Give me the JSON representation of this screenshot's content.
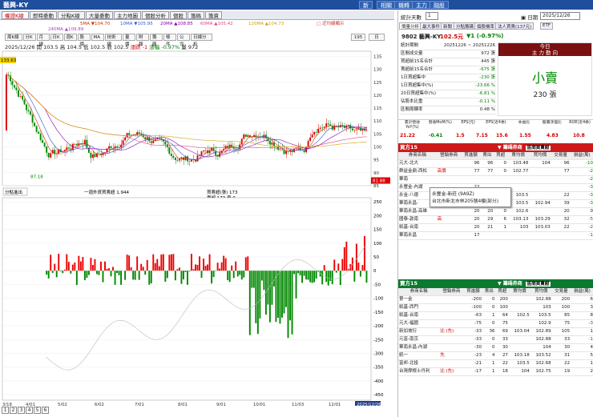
{
  "window": {
    "title": "藝興-KY",
    "tabs": [
      "新",
      "相關",
      "機轉",
      "主力",
      "融股"
    ]
  },
  "left_tabs": [
    "權證K線",
    "即時委動",
    "分點K線",
    "大量委動",
    "主力地圖",
    "個股分析",
    "個股",
    "籌碼",
    "籌資"
  ],
  "ma": [
    "5MA ▼104.70",
    "10MA ▼105.95",
    "20MA ▲108.85",
    "60MA ▲105.42",
    "120MA ▲104.73",
    "240MA ▲109.89"
  ],
  "ma_colors": [
    "#cc3300",
    "#3355cc",
    "#8800aa",
    "#e0457a",
    "#d4a000",
    "#aa44cc"
  ],
  "ma_note": "□ 近均線顯示",
  "toolbar": [
    "周K線",
    "分K",
    "月線",
    "日K",
    "週K",
    "股價",
    "MA",
    "技術線",
    "量價",
    "財報",
    "籌碼",
    "條件",
    "公司",
    "日線分析"
  ],
  "toolbar_select": "195",
  "price": {
    "date": "2025/12/26",
    "open": "開 103.5",
    "high": "高 104.5",
    "low": "低 102.5",
    "close": "收 102.5",
    "chg": "漲跌 -1",
    "pct": "漲幅 -0.97%",
    "vol": "量 972"
  },
  "price_ticks": [
    "135",
    "130",
    "125",
    "120",
    "115",
    "110",
    "105",
    "100",
    "95",
    "90",
    "85"
  ],
  "price_marker": "133.63",
  "low_marker": "81.88",
  "low_label": "87.18",
  "sub_select": "分點進出",
  "sub_legend": "一週外資買賣超 1,944",
  "sub_sell": "賣超 173 量 0",
  "sub_buy": "買賣超(張) 173",
  "sub_ticks": [
    "250",
    "200",
    "150",
    "100",
    "50",
    "0",
    "-50",
    "-100",
    "-150",
    "-200",
    "-250",
    "-300",
    "-350",
    "-400",
    "-450"
  ],
  "x_ticks": [
    "3/18\n2025",
    "4/01",
    "5/02",
    "6/02",
    "7/01",
    "8/01",
    "9/01",
    "10/01",
    "11/03",
    "12/01",
    "2025/12/26"
  ],
  "pages": [
    "1",
    "2",
    "3",
    "4",
    "5",
    "6"
  ],
  "right": {
    "tools": {
      "label": "統計天數",
      "value": "1",
      "date_label": "日期",
      "date": "2025/12/26"
    },
    "tabs": [
      "價量分析",
      "最大事件",
      "新聞",
      "分點籌碼",
      "個股機率",
      "法人買賣(137元)",
      "ETF"
    ],
    "stock": {
      "name": "9802 藝興-KY",
      "price": "102.5元",
      "chg": "▼1 (-0.97%)"
    },
    "stats_title": "統計期間 20251226 ~ 20251226",
    "stats": [
      [
        "統計期間",
        "20251226 ~ 20251226"
      ],
      [
        "區間成交量",
        "972 張"
      ],
      [
        "買超前15名合計",
        "445 張"
      ],
      [
        "賣超前15名合計",
        "-675 張"
      ],
      [
        "1日買超集中",
        "-230 張"
      ],
      [
        "1日買超集中(%)",
        "-23.66 %"
      ],
      [
        "20日買超集中(%)",
        "-6.81 %"
      ],
      [
        "佔股本比重",
        "-0.11 %"
      ],
      [
        "區間周轉率",
        "0.48 %"
      ]
    ],
    "today_box": {
      "l1": "今日",
      "l2": "主 力 動 向",
      "big": "小賣",
      "amt": "230 張"
    },
    "fund_hdr": [
      "累計營收YoY(%)",
      "營收MoM(%)",
      "EPS(元)",
      "EPS(近4季)",
      "本益比",
      "股價淨值比",
      "ROE(近4季)"
    ],
    "fund_val": [
      "21.22",
      "-0.41",
      "1.5",
      "7.15",
      "15.6",
      "1.55",
      "4.83",
      "10.8"
    ],
    "buy_head": "買方15",
    "buy_sel": "籌碼券商",
    "buy_sel2": "區間買賣超",
    "cols": [
      "券商名稱",
      "營銷券商",
      "買進額",
      "賣出",
      "買超",
      "賣均價",
      "買均價",
      "交易量",
      "損益(萬)"
    ],
    "buy_rows": [
      [
        "元大-北大",
        "",
        "96",
        "96",
        "0",
        "103.48",
        "104",
        "96",
        "-10"
      ],
      [
        "群益金鼎-西松",
        "高價",
        "77",
        "77",
        "0",
        "102.77",
        "",
        "77",
        "-2"
      ],
      [
        "華南",
        "",
        "",
        "",
        "",
        "",
        "",
        "",
        "-2"
      ],
      [
        "永豐金-內湖",
        "",
        "22",
        "",
        "",
        "",
        "",
        "",
        "-3"
      ],
      [
        "永金-八德",
        "",
        "22",
        "22",
        "0",
        "103.5",
        "",
        "22",
        "-3"
      ],
      [
        "華南永昌-",
        "",
        "21",
        "30",
        "9",
        "103.5",
        "102.94",
        "39",
        "-3"
      ],
      [
        "華南永昌-高雄",
        "",
        "20",
        "20",
        "0",
        "102.6",
        "",
        "20",
        "0"
      ],
      [
        "國泰-敦南",
        "高",
        "20",
        "29",
        "6",
        "103.13",
        "103.29",
        "32",
        "-5"
      ],
      [
        "凱基-台南",
        "",
        "20",
        "21",
        "1",
        "103",
        "103.03",
        "22",
        "-2"
      ],
      [
        "華南永昌",
        "",
        "17",
        "",
        "",
        "",
        "",
        "",
        "-1"
      ]
    ],
    "tooltip": {
      "l1": "永豐金-新莊 (9A9Z)",
      "l2": "台北市新北市林205號4樓(部分)"
    },
    "sell_head": "賣方15",
    "sell_rows": [
      [
        "第一金",
        "",
        "-200",
        "0",
        "200",
        "",
        "102.88",
        "200",
        "6"
      ],
      [
        "凱基-西門",
        "",
        "-100",
        "0",
        "100",
        "",
        "103",
        "100",
        "3"
      ],
      [
        "凱基-台南",
        "",
        "-63",
        "1",
        "64",
        "102.5",
        "103.5",
        "85",
        "8"
      ],
      [
        "元大-福國",
        "",
        "-75",
        "0",
        "75",
        "",
        "102.9",
        "75",
        "-3"
      ],
      [
        "新加坡衍",
        "比 (先)",
        "-33",
        "36",
        "69",
        "103.04",
        "102.89",
        "105",
        "1"
      ],
      [
        "元富-南京",
        "",
        "-33",
        "0",
        "33",
        "",
        "102.88",
        "33",
        "-1"
      ],
      [
        "華南永昌-內湖",
        "",
        "-30",
        "0",
        "30",
        "",
        "104",
        "30",
        "4"
      ],
      [
        "統一",
        "先",
        "-23",
        "4",
        "27",
        "103.18",
        "103.52",
        "31",
        "5"
      ],
      [
        "富邦-北投",
        "",
        "-21",
        "1",
        "22",
        "103.5",
        "102.68",
        "22",
        "1"
      ],
      [
        "台灣摩根士丹利",
        "比 (先)",
        "-17",
        "1",
        "18",
        "104",
        "102.75",
        "19",
        "2"
      ]
    ]
  }
}
